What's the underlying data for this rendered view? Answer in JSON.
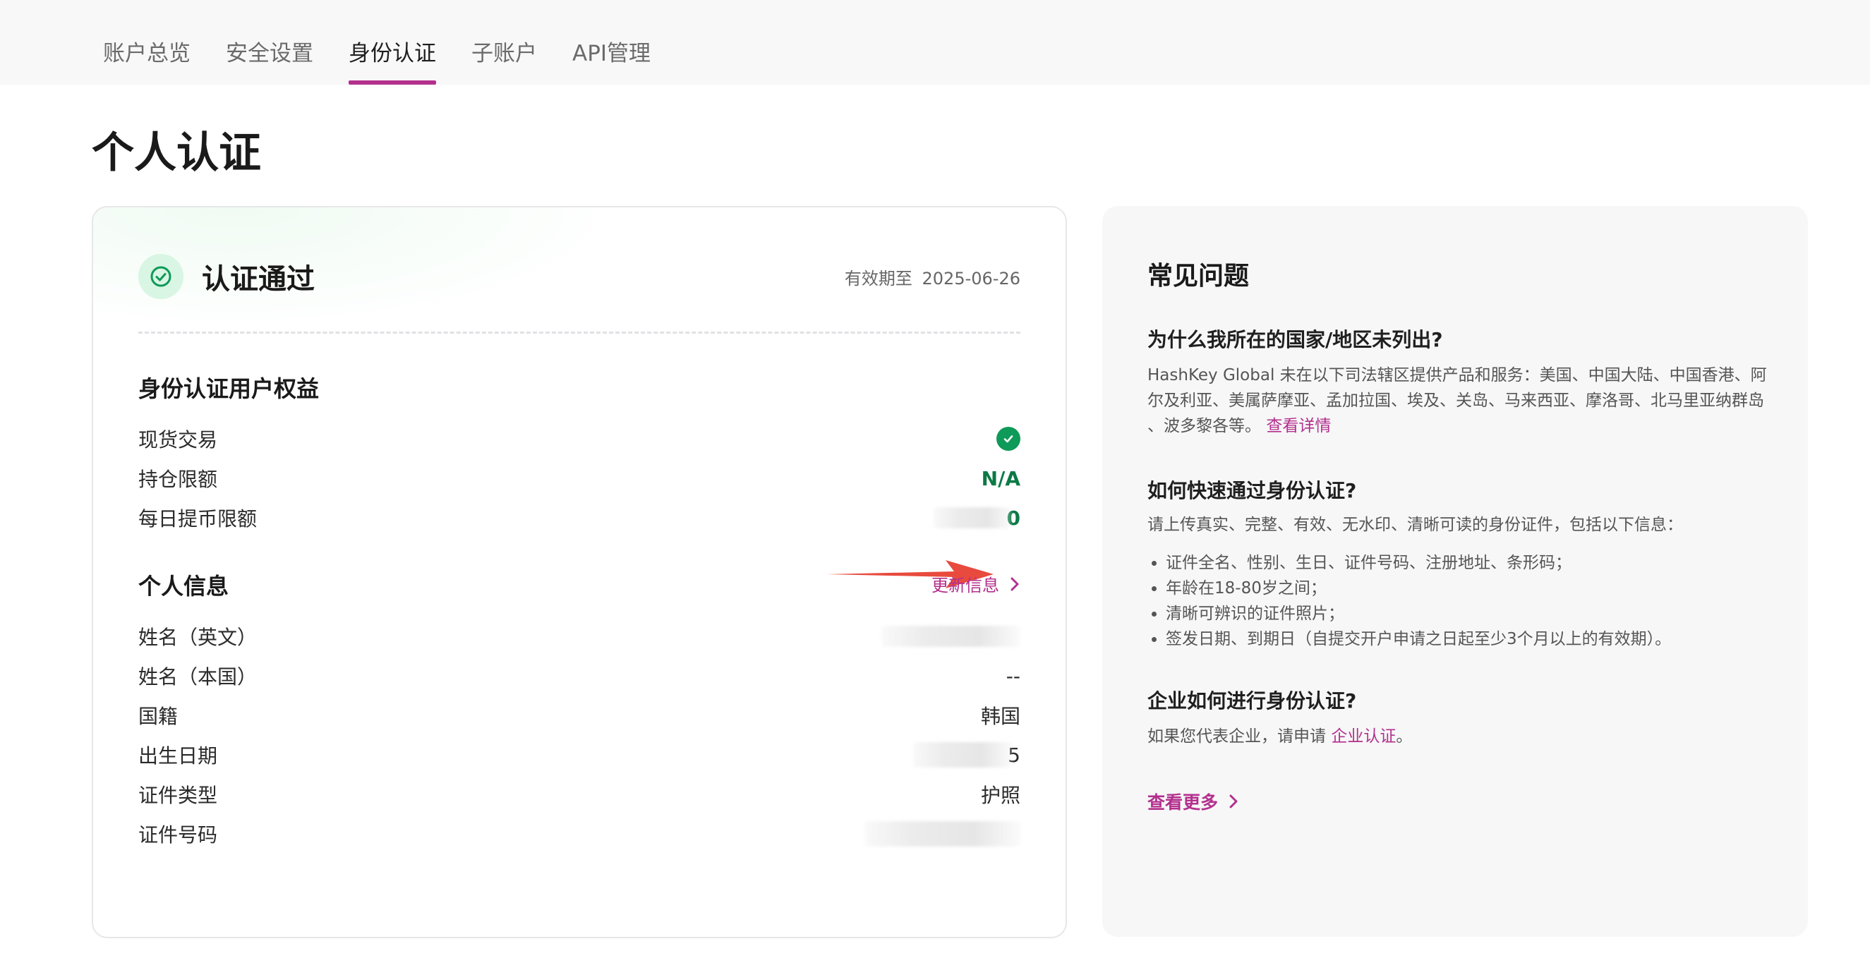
{
  "nav": {
    "tabs": [
      {
        "label": "账户总览"
      },
      {
        "label": "安全设置"
      },
      {
        "label": "身份认证",
        "active": true
      },
      {
        "label": "子账户"
      },
      {
        "label": "API管理"
      }
    ]
  },
  "page": {
    "title": "个人认证"
  },
  "status_card": {
    "status_title": "认证通过",
    "validity_label": "有效期至",
    "validity_date": "2025-06-26",
    "benefits_title": "身份认证用户权益",
    "benefits": [
      {
        "label": "现货交易",
        "value_type": "check"
      },
      {
        "label": "持仓限额",
        "value": "N/A"
      },
      {
        "label": "每日提币限额",
        "value": "0",
        "partially_obscured": true
      }
    ],
    "personal_title": "个人信息",
    "update_label": "更新信息",
    "personal_rows": [
      {
        "label": "姓名（英文）",
        "value": "",
        "obscured": true
      },
      {
        "label": "姓名（本国）",
        "value": "--"
      },
      {
        "label": "国籍",
        "value": "韩国"
      },
      {
        "label": "出生日期",
        "value": "5",
        "partially_obscured": true
      },
      {
        "label": "证件类型",
        "value": "护照"
      },
      {
        "label": "证件号码",
        "value": "",
        "obscured": true
      }
    ]
  },
  "faq": {
    "title": "常见问题",
    "q1": "为什么我所在的国家/地区未列出?",
    "a1": "HashKey Global 未在以下司法辖区提供产品和服务：美国、中国大陆、中国香港、阿尔及利亚、美属萨摩亚、孟加拉国、埃及、关岛、马来西亚、摩洛哥、北马里亚纳群岛 、波多黎各等。",
    "a1_link": "查看详情",
    "q2": "如何快速通过身份认证?",
    "a2": "请上传真实、完整、有效、无水印、清晰可读的身份证件，包括以下信息：",
    "a2_bullets": [
      "证件全名、性别、生日、证件号码、注册地址、条形码；",
      "年龄在18-80岁之间；",
      "清晰可辨识的证件照片；",
      "签发日期、到期日（自提交开户申请之日起至少3个月以上的有效期）。"
    ],
    "q3": "企业如何进行身份认证?",
    "a3": "如果您代表企业，请申请",
    "a3_link": "企业认证",
    "a3_suffix": "。",
    "more_label": "查看更多"
  },
  "colors": {
    "accent": "#b3308d",
    "success": "#0e9a58",
    "success_bg": "#d9f5e3",
    "annotation_arrow": "#e84a3d"
  }
}
